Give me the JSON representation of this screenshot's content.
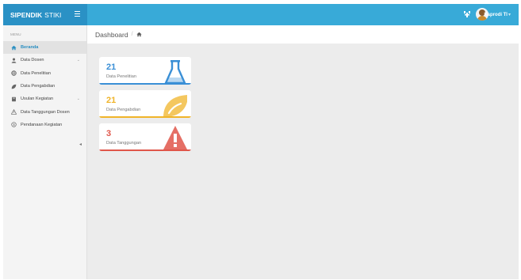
{
  "app": {
    "brand_bold": "SIPENDIK",
    "brand_light": "STIKI"
  },
  "topbar": {
    "user_name": "Kaprodi TI",
    "user_caret": "▾"
  },
  "sidebar": {
    "header": "MENU",
    "items": [
      {
        "label": "Beranda",
        "icon": "home-icon",
        "active": true
      },
      {
        "label": "Data Dosen",
        "icon": "user-icon",
        "chevron": "⌄"
      },
      {
        "label": "Data Penelitian",
        "icon": "globe-icon"
      },
      {
        "label": "Data Pengabdian",
        "icon": "leaf-icon"
      },
      {
        "label": "Usulan Kegiatan",
        "icon": "book-icon",
        "chevron": "⌄"
      },
      {
        "label": "Data Tanggungan Dosen",
        "icon": "warning-icon"
      },
      {
        "label": "Pendanaan Kegiatan",
        "icon": "money-icon"
      }
    ],
    "collapse_glyph": "◂"
  },
  "breadcrumb": {
    "title": "Dashboard",
    "separator": "/"
  },
  "cards": [
    {
      "value": "21",
      "label": "Data Penelitian",
      "color": "#3a8fd6",
      "icon": "flask-icon"
    },
    {
      "value": "21",
      "label": "Data Pengabdian",
      "color": "#f0b429",
      "icon": "leaf-icon"
    },
    {
      "value": "3",
      "label": "Data Tanggungan",
      "color": "#e0564a",
      "icon": "warning-icon"
    }
  ],
  "colors": {
    "brand": "#2a91c5",
    "topbar": "#38aad8",
    "active": "#2b8fc1"
  }
}
